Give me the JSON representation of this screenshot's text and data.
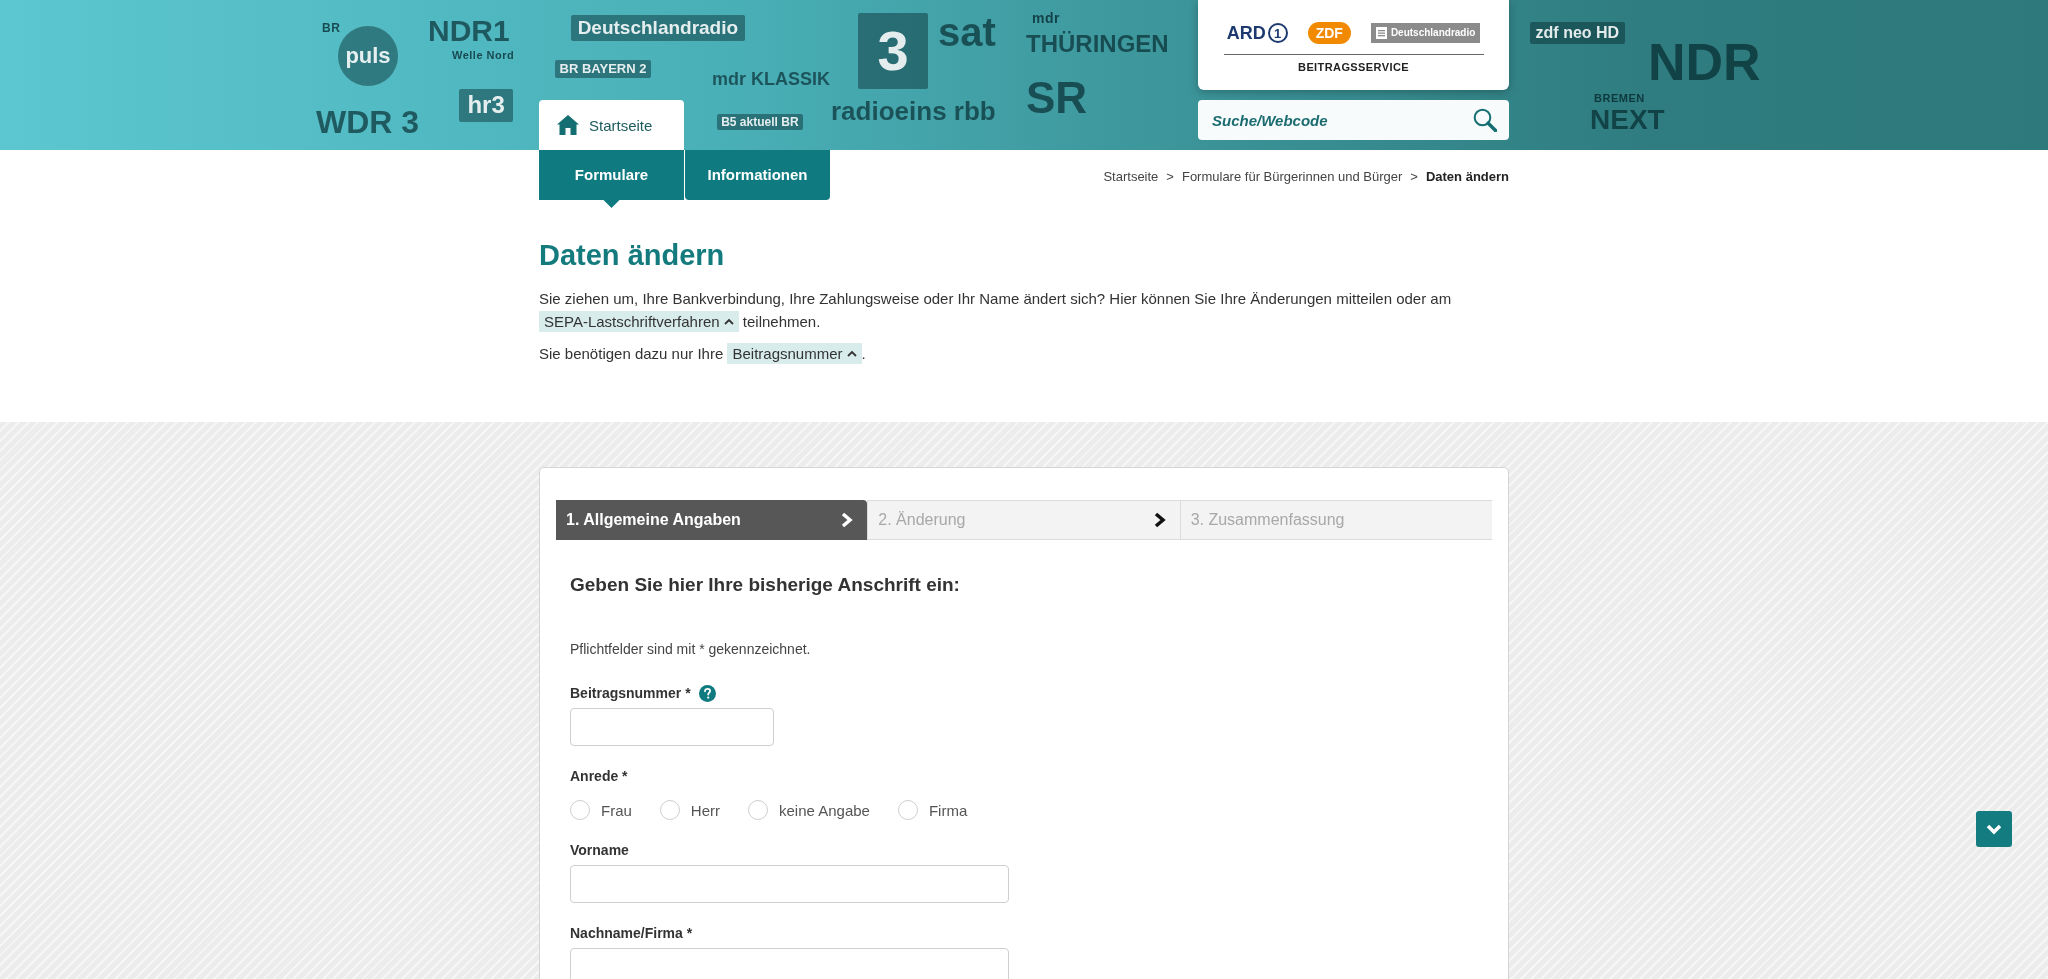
{
  "banner": {
    "logos": [
      {
        "kind": "small",
        "text": "BR"
      },
      {
        "kind": "circle",
        "text": "puls"
      },
      {
        "kind": "plain",
        "text": "NDR1"
      },
      {
        "kind": "small",
        "text": "Welle Nord"
      },
      {
        "kind": "box",
        "text": "Deutschlandradio"
      },
      {
        "kind": "box",
        "text": "BR BAYERN 2"
      },
      {
        "kind": "plain",
        "text": "mdr KLASSIK"
      },
      {
        "kind": "box",
        "text": "3"
      },
      {
        "kind": "plain",
        "text": "sat"
      },
      {
        "kind": "small",
        "text": "mdr"
      },
      {
        "kind": "plain",
        "text": "THÜRINGEN"
      },
      {
        "kind": "plain",
        "text": "WDR 3"
      },
      {
        "kind": "box",
        "text": "hr3"
      },
      {
        "kind": "box",
        "text": "B5 aktuell BR"
      },
      {
        "kind": "plain",
        "text": "radioeins rbb"
      },
      {
        "kind": "plain",
        "text": "SR"
      },
      {
        "kind": "box",
        "text": "zdf neo HD"
      },
      {
        "kind": "plain",
        "text": "NDR"
      },
      {
        "kind": "small",
        "text": "BREMEN"
      },
      {
        "kind": "plain",
        "text": "NEXT"
      }
    ]
  },
  "brand": {
    "logos": [
      {
        "kind": "ard",
        "text": "ARD",
        "mark": "1"
      },
      {
        "kind": "zdf",
        "text": "ZDF"
      },
      {
        "kind": "dlf",
        "text": "Deutschlandradio"
      }
    ],
    "caption": "BEITRAGSSERVICE"
  },
  "home_tab": {
    "label": "Startseite"
  },
  "search": {
    "placeholder": "Suche/Webcode"
  },
  "nav": [
    {
      "label": "Formulare",
      "selected": true
    },
    {
      "label": "Informationen",
      "selected": false
    }
  ],
  "breadcrumb": [
    {
      "label": "Startseite",
      "current": false
    },
    {
      "separator": ">",
      "label": "Formulare für Bürgerinnen und Bürger",
      "current": false
    },
    {
      "separator": ">",
      "label": "Daten ändern",
      "current": true
    }
  ],
  "page_title": "Daten ändern",
  "intro": [
    [
      {
        "kind": "text",
        "text": "Sie ziehen um, Ihre Bankverbindung, Ihre Zahlungsweise oder Ihr Name ändert sich? Hier können Sie Ihre Änderungen mitteilen oder am "
      },
      {
        "kind": "term",
        "text": "SEPA-Lastschriftverfahren"
      },
      {
        "kind": "text",
        "text": " teilnehmen."
      }
    ],
    [
      {
        "kind": "text",
        "text": "Sie benötigen dazu nur Ihre "
      },
      {
        "kind": "term",
        "text": "Beitragsnummer"
      },
      {
        "kind": "text",
        "text": "."
      }
    ]
  ],
  "form": {
    "steps": [
      {
        "label": "1. Allgemeine Angaben",
        "selected": true
      },
      {
        "label": "2. Änderung",
        "selected": false
      },
      {
        "label": "3. Zusammenfassung",
        "selected": false
      }
    ],
    "heading": "Geben Sie hier Ihre bisherige Anschrift ein:",
    "note": "Pflichtfelder sind mit * gekennzeichnet.",
    "fields": [
      {
        "kind": "short_text",
        "label": "Beitragsnummer *",
        "help": true
      },
      {
        "kind": "radio",
        "label": "Anrede *",
        "options": [
          {
            "label": "Frau",
            "selected": false
          },
          {
            "label": "Herr",
            "selected": false
          },
          {
            "label": "keine Angabe",
            "selected": false
          },
          {
            "label": "Firma",
            "selected": false
          }
        ]
      },
      {
        "kind": "text",
        "label": "Vorname"
      },
      {
        "kind": "text",
        "label": "Nachname/Firma *"
      }
    ]
  }
}
